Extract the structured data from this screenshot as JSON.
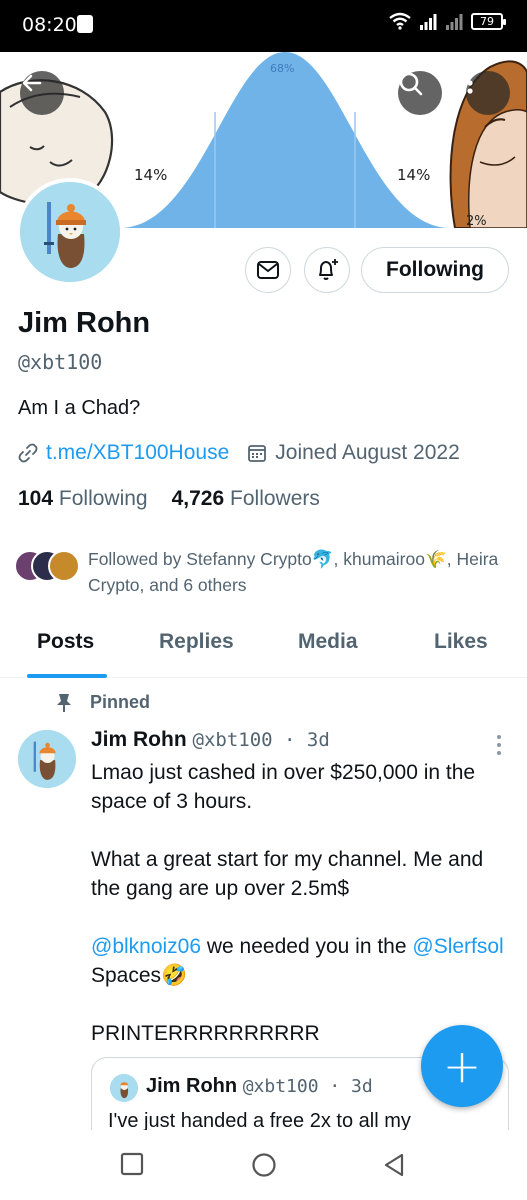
{
  "status_bar": {
    "time": "08:20",
    "battery": "79"
  },
  "banner": {
    "label_top": "68%",
    "label_left": "14%",
    "label_right": "14%",
    "label_corner": "2%"
  },
  "profile": {
    "display_name": "Jim Rohn",
    "handle": "@xbt100",
    "bio": "Am I a Chad?",
    "link": "t.me/XBT100House",
    "joined": "Joined August 2022",
    "following_count": "104",
    "following_label": "Following",
    "followers_count": "4,726",
    "followers_label": "Followers",
    "followed_by": "Followed by Stefanny Crypto🐬, khumairoo🌾, Heira Crypto, and 6 others",
    "follow_button": "Following"
  },
  "tabs": [
    {
      "label": "Posts"
    },
    {
      "label": "Replies"
    },
    {
      "label": "Media"
    },
    {
      "label": "Likes"
    }
  ],
  "post": {
    "pinned_label": "Pinned",
    "author": "Jim Rohn",
    "meta": "@xbt100 · 3d",
    "line1": "Lmao just cashed in over $250,000 in the space of 3 hours.",
    "line2": "What a great start for my channel. Me and the gang are up over 2.5m$",
    "mention1": "@blknoiz06",
    "text3a": " we needed you in the ",
    "mention2": "@Slerfsol",
    "text3b": " Spaces🤣",
    "line4": "PRINTERRRRRRRRRR"
  },
  "quote": {
    "author": "Jim Rohn",
    "meta": "@xbt100 · 3d",
    "text": "I've just handed a free 2x to all my"
  },
  "fab_label": "+",
  "colors": {
    "accent": "#1d9bf0",
    "banner_blue": "#6fb3e8"
  }
}
